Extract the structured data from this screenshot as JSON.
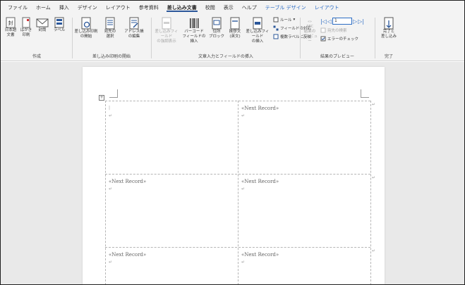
{
  "tabs": [
    "ファイル",
    "ホーム",
    "挿入",
    "デザイン",
    "レイアウト",
    "参考資料",
    "差し込み文書",
    "校閲",
    "表示",
    "ヘルプ",
    "テーブル デザイン",
    "レイアウト"
  ],
  "active_tab_index": 6,
  "ribbon": {
    "create": {
      "label": "作成",
      "envelope_label": "封筒",
      "label_label": "ラベル",
      "hagaki_label": "はがき\n印刷",
      "nihon_label": "日本語\n文書"
    },
    "start_merge": {
      "label": "差し込み印刷の開始",
      "start_label": "差し込み印刷\nの開始",
      "recipients_label": "宛先の\n選択",
      "edit_list_label": "アドレス帳\nの編集"
    },
    "insert_fields": {
      "label": "文章入力とフィールドの挿入",
      "highlight_label": "差し込みフィールド\nの強調表示",
      "barcode_label": "バーコード\nフィールドの挿入",
      "address_block_label": "住所\nブロック",
      "greeting_label": "挨拶文\n(英文)",
      "insert_field_label": "差し込みフィールド\nの挿入",
      "rules_label": "ルール",
      "match_fields_label": "フィールドの対応",
      "update_labels_label": "複数ラベルに反映"
    },
    "preview": {
      "label": "結果のプレビュー",
      "preview_results_label": "結果の\nプレビュー",
      "record_value": "1",
      "find_recipient_label": "宛先の検索",
      "check_errors_label": "エラーのチェック"
    },
    "finish": {
      "label": "完了",
      "finish_merge_label": "完了と\n差し込み"
    }
  },
  "document": {
    "cells": [
      "",
      "«Next Record»",
      "«Next Record»",
      "«Next Record»",
      "«Next Record»",
      "«Next Record»"
    ],
    "pilcrow": "↵"
  },
  "colors": {
    "accent": "#2b579a",
    "tab_blue": "#2b6cc4",
    "ribbon_bg": "#f3f3f3",
    "doc_bg": "#e9e9e9"
  }
}
